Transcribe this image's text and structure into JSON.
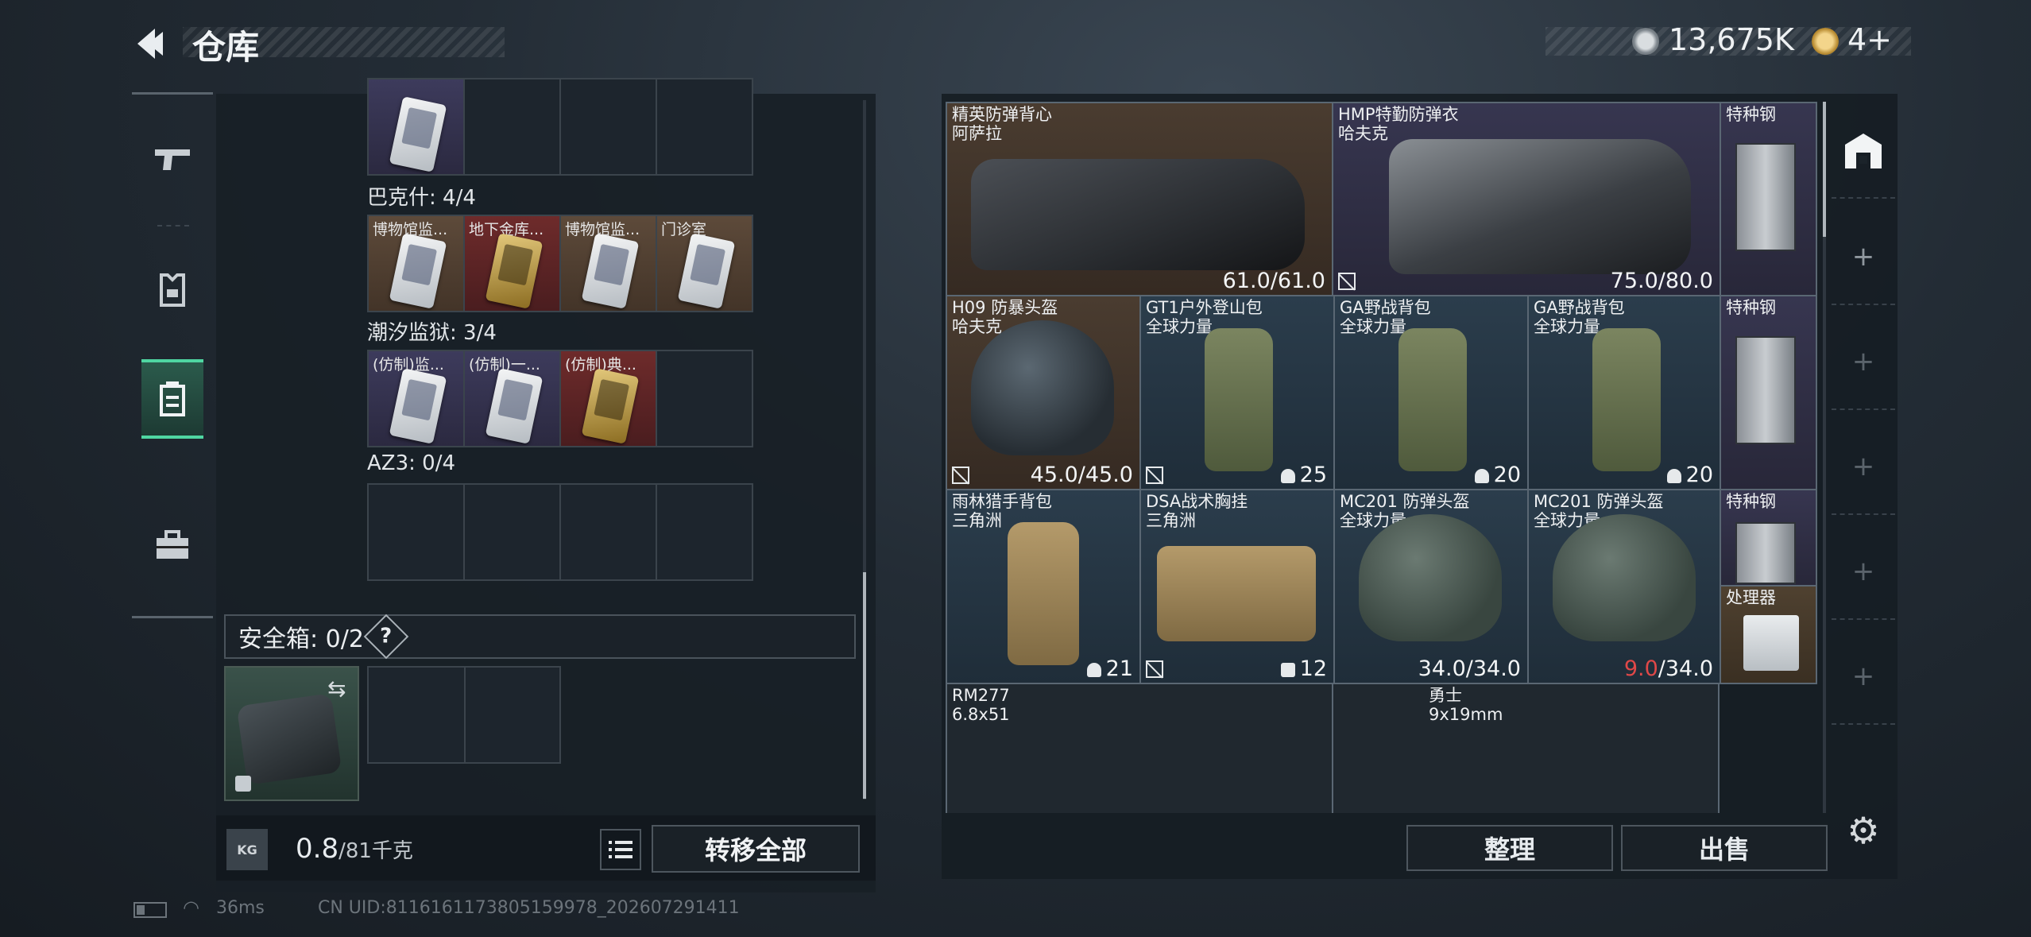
{
  "header": {
    "title": "仓库",
    "money": "13,675K",
    "tickets": "4+"
  },
  "left": {
    "groups": [
      {
        "label": "巴克什: 4/4",
        "items": [
          {
            "name": "博物馆监...",
            "rarity": "brown"
          },
          {
            "name": "地下金库...",
            "rarity": "red"
          },
          {
            "name": "博物馆监...",
            "rarity": "brown"
          },
          {
            "name": "门诊室",
            "rarity": "brown"
          }
        ]
      },
      {
        "label": "潮汐监狱: 3/4",
        "items": [
          {
            "name": "(仿制)监...",
            "rarity": "purple"
          },
          {
            "name": "(仿制)一...",
            "rarity": "purple"
          },
          {
            "name": "(仿制)典...",
            "rarity": "red"
          }
        ]
      },
      {
        "label": "AZ3: 0/4",
        "items": []
      }
    ],
    "safe_label": "安全箱: 0/2",
    "safe_help": "?",
    "weight_current": "0.8",
    "weight_max": "/81千克",
    "kg_icon_text": "KG",
    "transfer_label": "转移全部"
  },
  "status": {
    "ping": "36ms",
    "uid": "CN UID:8116161173805159978_202607291411"
  },
  "grid": {
    "items": [
      {
        "name": "精英防弹背心",
        "sub": "阿萨拉",
        "value": "61.0/61.0",
        "low": "",
        "no_repair": false
      },
      {
        "name": "HMP特勤防弹衣",
        "sub": "哈夫克",
        "value": "75.0/80.0",
        "low": "",
        "no_repair": true
      },
      {
        "name": "特种钢",
        "sub": "",
        "value": "",
        "low": "",
        "no_repair": false
      },
      {
        "name": "H09 防暴头盔",
        "sub": "哈夫克",
        "value": "45.0/45.0",
        "low": "",
        "no_repair": true
      },
      {
        "name": "GT1户外登山包",
        "sub": "全球力量",
        "value": "25",
        "low": "",
        "no_repair": true
      },
      {
        "name": "GA野战背包",
        "sub": "全球力量",
        "value": "20",
        "low": "",
        "no_repair": false
      },
      {
        "name": "GA野战背包",
        "sub": "全球力量",
        "value": "20",
        "low": "",
        "no_repair": false
      },
      {
        "name": "特种钢",
        "sub": "",
        "value": "",
        "low": "",
        "no_repair": false
      },
      {
        "name": "雨林猎手背包",
        "sub": "三角洲",
        "value": "21",
        "low": "",
        "no_repair": false
      },
      {
        "name": "DSA战术胸挂",
        "sub": "三角洲",
        "value": "12",
        "low": "",
        "no_repair": true
      },
      {
        "name": "MC201 防弹头盔",
        "sub": "全球力量",
        "value": "34.0/34.0",
        "low": "",
        "no_repair": false
      },
      {
        "name": "MC201 防弹头盔",
        "sub": "全球力量",
        "value": "/34.0",
        "low": "9.0",
        "no_repair": false
      },
      {
        "name": "特种钢",
        "sub": "",
        "value": "",
        "low": "",
        "no_repair": false
      },
      {
        "name": "处理器",
        "sub": "",
        "value": "",
        "low": "",
        "no_repair": false
      },
      {
        "name": "RM277",
        "sub": "6.8x51",
        "value": "",
        "low": "",
        "no_repair": false
      },
      {
        "name": "勇士",
        "sub": "9x19mm",
        "value": "",
        "low": "",
        "no_repair": false
      }
    ]
  },
  "right_sidebar": {
    "add_symbol": "+"
  },
  "actions": {
    "sort_label": "整理",
    "sell_label": "出售"
  },
  "colors": {
    "accent": "#4fd6a2",
    "low_durability": "#e04848"
  }
}
